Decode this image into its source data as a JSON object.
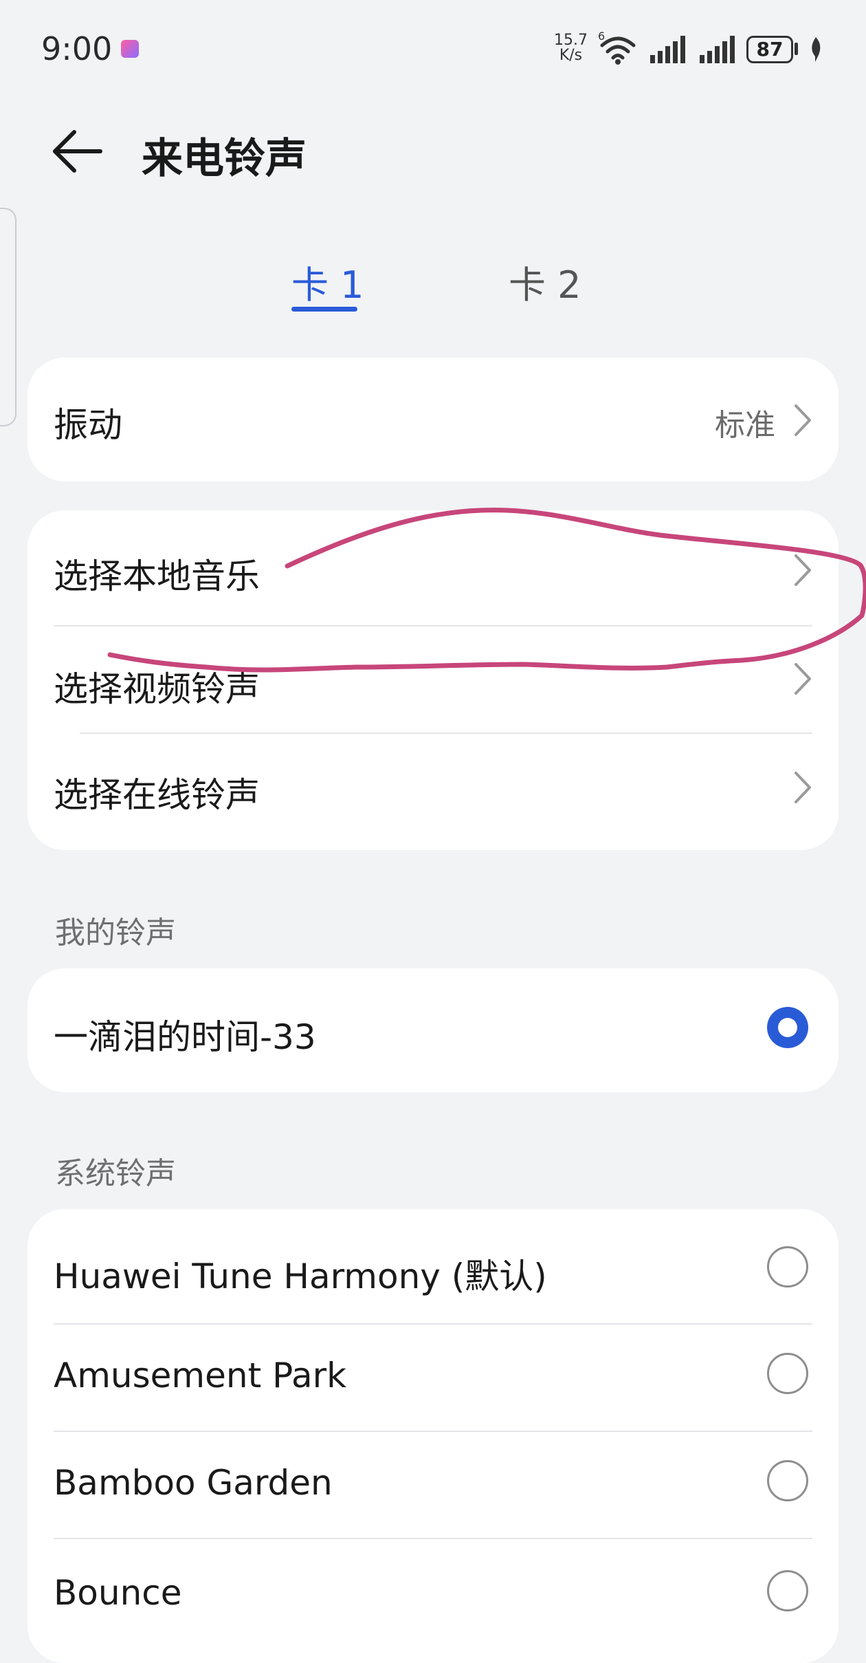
{
  "status_bar": {
    "time": "9:00",
    "net_speed_value": "15.7",
    "net_speed_unit": "K/s",
    "wifi_label": "6",
    "battery": "87"
  },
  "header": {
    "title": "来电铃声"
  },
  "tabs": [
    {
      "label": "卡 1",
      "active": true
    },
    {
      "label": "卡 2",
      "active": false
    }
  ],
  "vibration": {
    "label": "振动",
    "value": "标准"
  },
  "ringtone_sources": [
    {
      "label": "选择本地音乐"
    },
    {
      "label": "选择视频铃声"
    },
    {
      "label": "选择在线铃声"
    }
  ],
  "my_ringtones": {
    "section_label": "我的铃声",
    "items": [
      {
        "label": "一滴泪的时间-33",
        "selected": true
      }
    ]
  },
  "system_ringtones": {
    "section_label": "系统铃声",
    "items": [
      {
        "label": "Huawei Tune Harmony (默认)",
        "selected": false
      },
      {
        "label": "Amusement Park",
        "selected": false
      },
      {
        "label": "Bamboo Garden",
        "selected": false
      },
      {
        "label": "Bounce",
        "selected": false
      }
    ]
  },
  "colors": {
    "accent": "#2a5bd7",
    "background": "#f1f3f5",
    "card": "#ffffff",
    "annotation_stroke": "#c7467a"
  }
}
